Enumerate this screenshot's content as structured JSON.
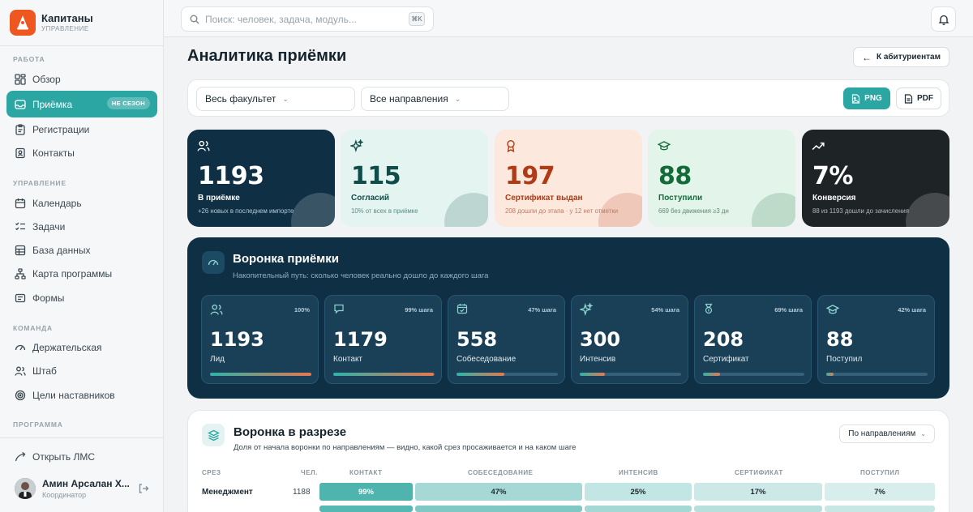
{
  "brand": {
    "name": "Капитаны",
    "subtitle": "УПРАВЛЕНИЕ"
  },
  "sidebar": {
    "sections": {
      "work": "РАБОТА",
      "management": "УПРАВЛЕНИЕ",
      "team": "КОМАНДА",
      "program": "ПРОГРАММА"
    },
    "items": [
      {
        "label": "Обзор",
        "icon": "dashboard-icon"
      },
      {
        "label": "Приёмка",
        "icon": "inbox-icon",
        "badge": "НЕ СЕЗОН",
        "active": true
      },
      {
        "label": "Регистрации",
        "icon": "clipboard-icon"
      },
      {
        "label": "Контакты",
        "icon": "contacts-icon"
      },
      {
        "label": "Календарь",
        "icon": "calendar-icon"
      },
      {
        "label": "Задачи",
        "icon": "tasks-icon"
      },
      {
        "label": "База данных",
        "icon": "database-icon"
      },
      {
        "label": "Карта программы",
        "icon": "sitemap-icon"
      },
      {
        "label": "Формы",
        "icon": "forms-icon"
      },
      {
        "label": "Держательская",
        "icon": "gauge-icon"
      },
      {
        "label": "Штаб",
        "icon": "users-icon"
      },
      {
        "label": "Цели наставников",
        "icon": "target-icon"
      },
      {
        "label": "Открыть ЛМС",
        "icon": "external-link-icon"
      }
    ],
    "user": {
      "name": "Амин Арсалан Х...",
      "role": "Координатор"
    }
  },
  "topbar": {
    "search_placeholder": "Поиск: человек, задача, модуль...",
    "search_shortcut": "⌘K"
  },
  "page": {
    "title": "Аналитика приёмки",
    "back_label": "К абитуриентам",
    "filters": {
      "faculty": "Весь факультет",
      "direction": "Все направления"
    },
    "export": {
      "png": "PNG",
      "pdf": "PDF"
    }
  },
  "kpis": [
    {
      "value": "1193",
      "label": "В приёмке",
      "sub": "+26 новых в последнем импорте",
      "icon": "users-icon",
      "bg": "#0e2f44",
      "fg": "#ffffff",
      "subfg": "#b4cad6"
    },
    {
      "value": "115",
      "label": "Согласий",
      "sub": "10% от всех в приёмке",
      "icon": "sparkles-icon",
      "bg": "#e4f5f1",
      "fg": "#0e4d4a",
      "subfg": "#5d8b86"
    },
    {
      "value": "197",
      "label": "Сертификат выдан",
      "sub": "208 дошли до этапа · у 12 нет отметки",
      "icon": "award-icon",
      "bg": "#fde8de",
      "fg": "#b03a14",
      "subfg": "#b97c62"
    },
    {
      "value": "88",
      "label": "Поступили",
      "sub": "669 без движения ≥3 дн",
      "icon": "graduation-cap-icon",
      "bg": "#e3f4ea",
      "fg": "#146b3a",
      "subfg": "#5d8b70"
    },
    {
      "value": "7%",
      "label": "Конверсия",
      "sub": "88 из 1193 дошли до зачисления",
      "icon": "trending-up-icon",
      "bg": "#1e2326",
      "fg": "#ffffff",
      "subfg": "#b0b8bd"
    }
  ],
  "funnel": {
    "title": "Воронка приёмки",
    "subtitle": "Накопительный путь: сколько человек реально дошло до каждого шага",
    "stages": [
      {
        "value": "1193",
        "label": "Лид",
        "pct": "100%",
        "fill": 1.0,
        "icon": "users-icon"
      },
      {
        "value": "1179",
        "label": "Контакт",
        "pct": "99% шага",
        "fill": 0.99,
        "icon": "message-icon"
      },
      {
        "value": "558",
        "label": "Собеседование",
        "pct": "47% шага",
        "fill": 0.47,
        "icon": "calendar-check-icon"
      },
      {
        "value": "300",
        "label": "Интенсив",
        "pct": "54% шага",
        "fill": 0.25,
        "icon": "sparkles-icon"
      },
      {
        "value": "208",
        "label": "Сертификат",
        "pct": "69% шага",
        "fill": 0.17,
        "icon": "medal-icon"
      },
      {
        "value": "88",
        "label": "Поступил",
        "pct": "42% шага",
        "fill": 0.07,
        "icon": "graduation-cap-icon"
      }
    ]
  },
  "breakdown": {
    "title": "Воронка в разрезе",
    "subtitle": "Доля от начала воронки по направлениям — видно, какой срез просаживается и на каком шаге",
    "mode": "По направлениям",
    "headers": {
      "slice": "СРЕЗ",
      "count": "ЧЕЛ.",
      "contact": "КОНТАКТ",
      "interview": "СОБЕСЕДОВАНИЕ",
      "intensive": "ИНТЕНСИВ",
      "certificate": "СЕРТИФИКАТ",
      "enrolled": "ПОСТУПИЛ"
    },
    "rows": [
      {
        "name": "Менеджмент",
        "count": "1188",
        "cells": [
          "99%",
          "47%",
          "25%",
          "17%",
          "7%"
        ]
      }
    ]
  }
}
